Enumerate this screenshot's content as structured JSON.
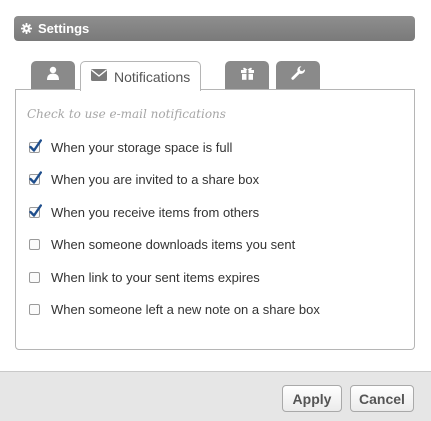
{
  "window": {
    "title": "Settings",
    "icon": "gear-icon"
  },
  "tabs": [
    {
      "id": "account",
      "icon": "user-icon",
      "label": "",
      "active": false
    },
    {
      "id": "notifications",
      "icon": "envelope-icon",
      "label": "Notifications",
      "active": true
    },
    {
      "id": "gifts",
      "icon": "gift-icon",
      "label": "",
      "active": false
    },
    {
      "id": "tools",
      "icon": "wrench-icon",
      "label": "",
      "active": false
    }
  ],
  "panel": {
    "hint": "Check to use e-mail notifications",
    "options": [
      {
        "label": "When your storage space is full",
        "checked": true
      },
      {
        "label": "When you are invited to a share box",
        "checked": true
      },
      {
        "label": "When you receive items from others",
        "checked": true
      },
      {
        "label": "When someone downloads items you sent",
        "checked": false
      },
      {
        "label": "When link to your sent items expires",
        "checked": false
      },
      {
        "label": "When someone left a new note on a share box",
        "checked": false
      }
    ]
  },
  "footer": {
    "apply_label": "Apply",
    "cancel_label": "Cancel"
  },
  "colors": {
    "titlebar": "#808080",
    "tab_inactive": "#8a8a8a",
    "check": "#1f4e8c",
    "footer": "#e6e6e6"
  }
}
